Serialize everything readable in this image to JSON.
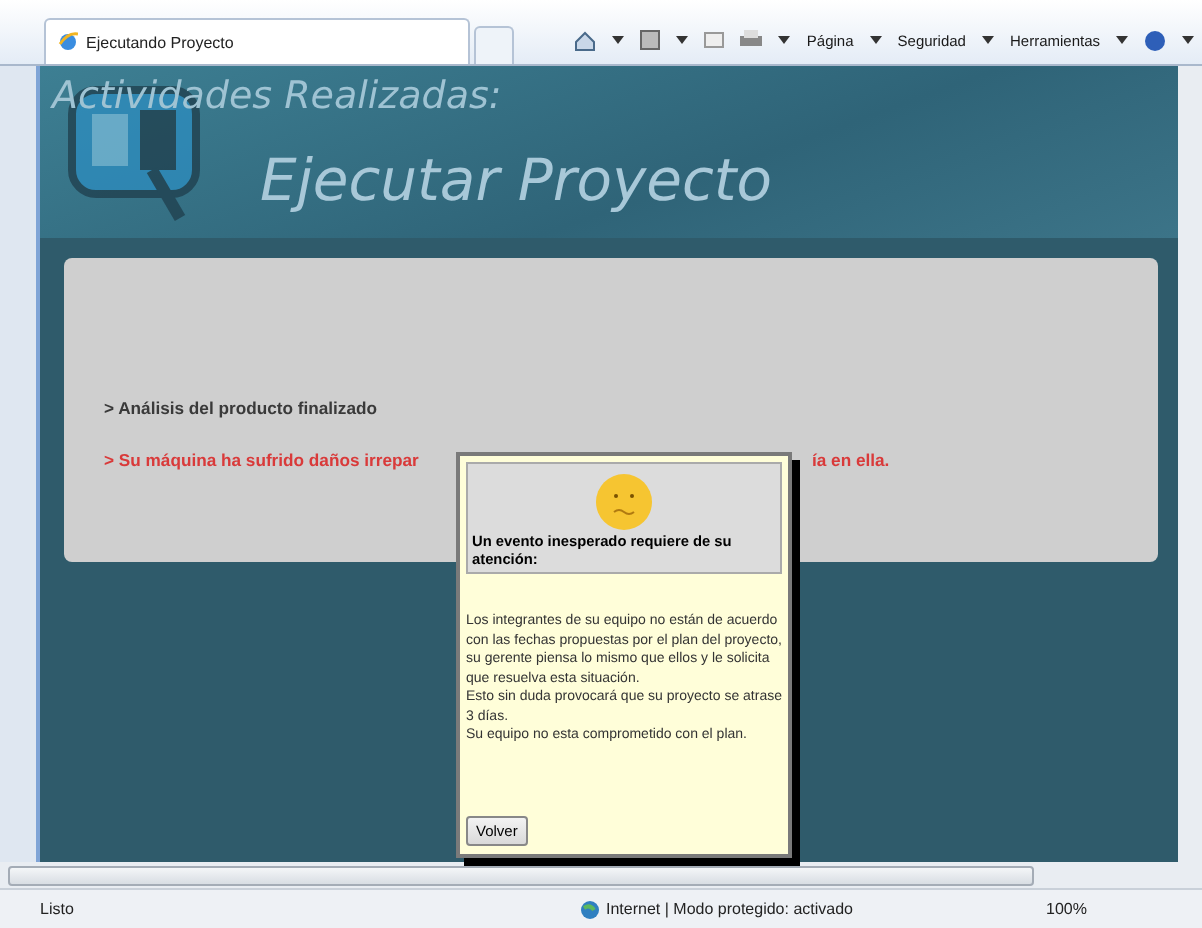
{
  "browser": {
    "tab_title": "Ejecutando Proyecto",
    "commands": [
      {
        "label": "Página"
      },
      {
        "label": "Seguridad"
      },
      {
        "label": "Herramientas"
      }
    ]
  },
  "header": {
    "subtitle": "Actividades Realizadas:",
    "title": "Ejecutar Proyecto"
  },
  "log": [
    {
      "kind": "info",
      "parts": [
        "> Análisis del producto finalizado"
      ]
    },
    {
      "kind": "alert",
      "parts": [
        "> Su máquina ha sufrido daños irrepar",
        "ía en ella."
      ]
    }
  ],
  "dialog": {
    "heading": "Un evento inesperado requiere de su atención:",
    "lines": [
      "Los integrantes de su equipo no están de acuerdo con las fechas propuestas por el plan del proyecto, su gerente piensa lo mismo que ellos y le solicita que resuelva esta situación.",
      "Esto sin duda provocará que su proyecto se atrase 3 días.",
      "Su equipo no esta comprometido con el plan."
    ],
    "button": "Volver"
  },
  "status_bar": {
    "status": "Listo",
    "zone": "Internet | Modo protegido: activado",
    "zoom": "100%"
  }
}
